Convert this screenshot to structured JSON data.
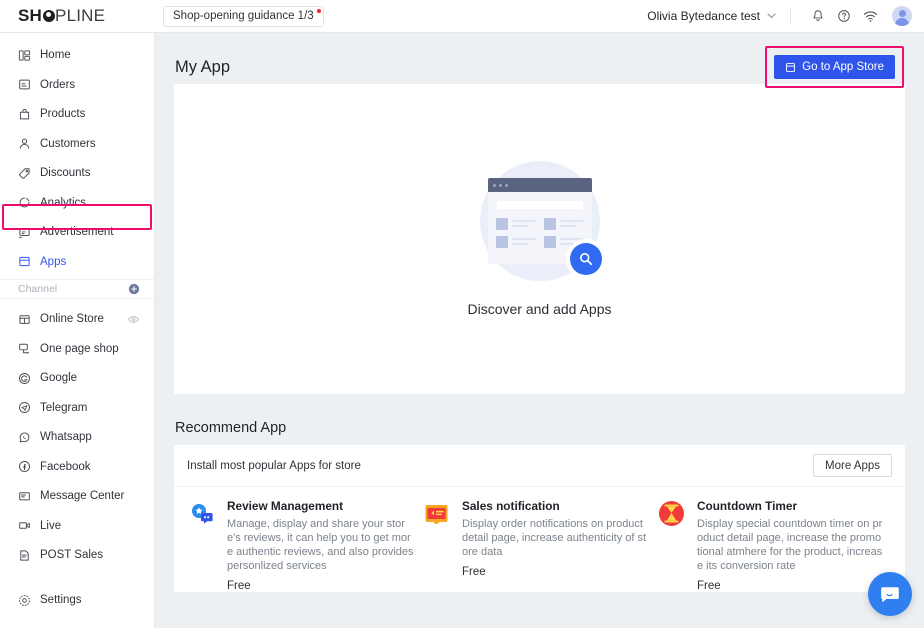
{
  "header": {
    "logo": "SHOPLINE",
    "logo_part1": "SH",
    "logo_part2": "PLINE",
    "guidance_chip": "Shop-opening guidance 1/3",
    "account_name": "Olivia Bytedance test",
    "icons": [
      "bell-icon",
      "help-icon",
      "wifi-icon",
      "avatar"
    ]
  },
  "sidebar": {
    "items": [
      {
        "label": "Home",
        "icon": "home-icon"
      },
      {
        "label": "Orders",
        "icon": "orders-icon"
      },
      {
        "label": "Products",
        "icon": "products-icon"
      },
      {
        "label": "Customers",
        "icon": "customers-icon"
      },
      {
        "label": "Discounts",
        "icon": "discounts-tag-icon"
      },
      {
        "label": "Analytics",
        "icon": "analytics-pie-icon"
      },
      {
        "label": "Advertisement",
        "icon": "advertisement-icon"
      },
      {
        "label": "Apps",
        "icon": "apps-icon",
        "active": true
      }
    ],
    "channel_label": "Channel",
    "channel_add": "plus-circle-icon",
    "channels": [
      {
        "label": "Online Store",
        "icon": "online-store-icon",
        "trailing": "eye-icon"
      },
      {
        "label": "One page shop",
        "icon": "one-page-shop-icon"
      },
      {
        "label": "Google",
        "icon": "google-icon"
      },
      {
        "label": "Telegram",
        "icon": "telegram-icon"
      },
      {
        "label": "Whatsapp",
        "icon": "whatsapp-icon"
      },
      {
        "label": "Facebook",
        "icon": "facebook-icon"
      },
      {
        "label": "Message Center",
        "icon": "message-center-icon"
      },
      {
        "label": "Live",
        "icon": "live-icon"
      },
      {
        "label": "POST Sales",
        "icon": "post-sales-icon"
      }
    ],
    "settings": {
      "label": "Settings",
      "icon": "gear-icon"
    }
  },
  "main": {
    "page_title": "My App",
    "app_store_button": "Go to App Store",
    "empty_state_text": "Discover and add Apps",
    "recommend_section_title": "Recommend App",
    "recommend_card_title": "Install most popular Apps for store",
    "more_apps_button": "More Apps",
    "apps": [
      {
        "name": "Review Management",
        "description": "Manage, display and share your store's reviews, it can help you to get more authentic reviews, and also provides personlized services",
        "price": "Free",
        "icon": "review-management-icon"
      },
      {
        "name": "Sales notification",
        "description": "Display order notifications on product detail page, increase authenticity of store data",
        "price": "Free",
        "icon": "sales-notification-icon"
      },
      {
        "name": "Countdown Timer",
        "description": "Display special countdown timer on product detail page, increase the promotional atmhere for the product, increase its conversion rate",
        "price": "Free",
        "icon": "countdown-timer-icon"
      }
    ]
  },
  "chat": {
    "icon": "chat-bubble-icon"
  },
  "colors": {
    "primary": "#2f54eb",
    "highlight": "#ec0d6e",
    "background": "#edf0f3",
    "card": "#ffffff",
    "text": "#2f343a",
    "muted": "#7b838c"
  }
}
